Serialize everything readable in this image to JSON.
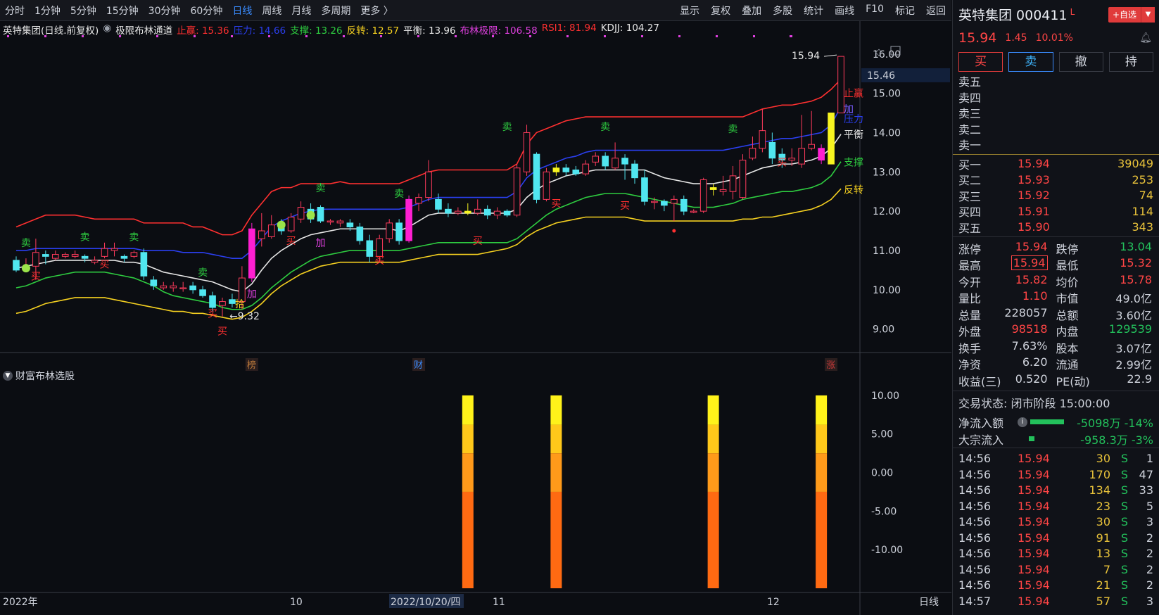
{
  "toolbar": {
    "periods": [
      "分时",
      "1分钟",
      "5分钟",
      "15分钟",
      "30分钟",
      "60分钟",
      "日线",
      "周线",
      "月线",
      "多周期",
      "更多 〉"
    ],
    "active_period": "日线",
    "tools": [
      "显示",
      "复权",
      "叠加",
      "多股",
      "统计",
      "画线",
      "F10",
      "标记",
      "返回"
    ]
  },
  "legend": {
    "title": "英特集团(日线.前复权)",
    "indicator": "极限布林通道",
    "items": [
      {
        "label": "止赢: 15.36",
        "color": "#ff3030"
      },
      {
        "label": "压力: 14.66",
        "color": "#2b3ff0"
      },
      {
        "label": "支撑: 13.26",
        "color": "#2ecc40"
      },
      {
        "label": "反转: 12.57",
        "color": "#f5d020"
      },
      {
        "label": "平衡: 13.96",
        "color": "#e6e6e6"
      },
      {
        "label": "布林极限: 106.58",
        "color": "#e040e0"
      },
      {
        "label": "RSI1: 81.94",
        "color": "#ff3030"
      },
      {
        "label": "KDJJ: 104.27",
        "color": "#e6e6e6"
      }
    ]
  },
  "sub_chart_title": "财富布林选股",
  "main_axis": [
    "16.00",
    "15.00",
    "14.00",
    "13.00",
    "12.00",
    "11.00",
    "10.00",
    "9.00"
  ],
  "current_price_tag": "15.46",
  "sub_axis": [
    "10.00",
    "5.00",
    "0.00",
    "-5.00",
    "-10.00"
  ],
  "x_axis": {
    "labels": [
      "2022年",
      "10",
      "2022/10/20/四",
      "11",
      "12"
    ],
    "period_label": "日线"
  },
  "annotations": {
    "high_label": "15.94",
    "low_label": "9.32",
    "band_labels": [
      "止赢",
      "加",
      "压力",
      "平衡",
      "支撑",
      "反转"
    ],
    "buy_mark": "买",
    "sell_mark": "卖",
    "add_mark": "加",
    "pick_mark": "拾",
    "markers": [
      "榜",
      "财",
      "涨"
    ]
  },
  "chart_data": {
    "type": "candlestick",
    "ylim": [
      8.6,
      16.3
    ],
    "candles": [
      [
        10.75,
        10.5,
        10.85,
        10.45
      ],
      [
        10.55,
        10.6,
        10.8,
        10.45
      ],
      [
        10.6,
        10.95,
        11.3,
        10.25
      ],
      [
        10.9,
        10.85,
        11.0,
        10.65
      ],
      [
        10.8,
        10.9,
        11.0,
        10.75
      ],
      [
        10.85,
        10.9,
        10.95,
        10.8
      ],
      [
        10.85,
        10.9,
        11.0,
        10.8
      ],
      [
        10.85,
        10.8,
        10.9,
        10.7
      ],
      [
        10.7,
        10.75,
        10.85,
        10.65
      ],
      [
        10.85,
        11.05,
        11.2,
        10.8
      ],
      [
        11.0,
        11.05,
        11.2,
        10.85
      ],
      [
        10.85,
        10.8,
        10.9,
        10.7
      ],
      [
        10.85,
        10.95,
        11.0,
        10.8
      ],
      [
        10.95,
        10.35,
        11.05,
        10.25
      ],
      [
        10.25,
        10.1,
        10.35,
        10.0
      ],
      [
        10.05,
        10.1,
        10.2,
        10.0
      ],
      [
        10.05,
        10.1,
        10.2,
        9.95
      ],
      [
        10.05,
        10.05,
        10.2,
        9.95
      ],
      [
        10.1,
        10.0,
        10.2,
        9.9
      ],
      [
        10.0,
        9.85,
        10.1,
        9.8
      ],
      [
        9.85,
        9.55,
        9.95,
        9.45
      ],
      [
        9.6,
        9.7,
        9.8,
        9.32
      ],
      [
        9.75,
        9.65,
        9.9,
        9.55
      ],
      [
        9.7,
        10.3,
        10.6,
        9.5
      ],
      [
        10.3,
        11.55,
        11.7,
        10.2
      ],
      [
        11.3,
        11.5,
        11.95,
        11.1
      ],
      [
        11.35,
        11.65,
        11.9,
        11.3
      ],
      [
        11.65,
        11.5,
        11.8,
        11.4
      ],
      [
        11.5,
        11.85,
        11.95,
        11.45
      ],
      [
        11.8,
        12.1,
        12.25,
        11.7
      ],
      [
        12.05,
        11.8,
        12.2,
        11.7
      ],
      [
        12.1,
        11.75,
        12.15,
        11.7
      ],
      [
        11.75,
        11.75,
        11.8,
        11.65
      ],
      [
        11.7,
        11.75,
        11.8,
        11.6
      ],
      [
        11.7,
        11.6,
        11.8,
        11.5
      ],
      [
        11.6,
        11.25,
        11.7,
        11.15
      ],
      [
        11.25,
        10.85,
        11.4,
        10.7
      ],
      [
        10.85,
        11.3,
        11.4,
        10.7
      ],
      [
        11.3,
        11.7,
        11.8,
        11.2
      ],
      [
        11.7,
        11.25,
        11.8,
        11.15
      ],
      [
        11.25,
        12.3,
        12.4,
        11.2
      ],
      [
        12.2,
        12.35,
        12.45,
        12.0
      ],
      [
        12.35,
        13.0,
        13.3,
        12.25
      ],
      [
        12.3,
        12.05,
        12.45,
        11.95
      ],
      [
        12.05,
        11.95,
        12.2,
        11.85
      ],
      [
        11.95,
        12.0,
        12.1,
        11.9
      ],
      [
        12.0,
        11.95,
        12.2,
        11.9
      ],
      [
        11.95,
        12.05,
        12.3,
        11.9
      ],
      [
        12.05,
        11.9,
        12.15,
        11.8
      ],
      [
        11.9,
        12.0,
        12.1,
        11.8
      ],
      [
        12.0,
        11.9,
        12.05,
        11.85
      ],
      [
        11.9,
        13.1,
        13.2,
        11.85
      ],
      [
        13.0,
        14.0,
        14.2,
        12.9
      ],
      [
        13.45,
        12.3,
        13.5,
        12.2
      ],
      [
        12.3,
        13.0,
        13.1,
        12.25
      ],
      [
        13.0,
        13.1,
        13.2,
        12.9
      ],
      [
        13.1,
        13.0,
        13.2,
        12.9
      ],
      [
        13.05,
        12.95,
        13.15,
        12.9
      ],
      [
        12.95,
        13.2,
        13.3,
        12.9
      ],
      [
        13.25,
        13.4,
        13.5,
        13.15
      ],
      [
        13.4,
        13.15,
        13.5,
        13.05
      ],
      [
        13.1,
        13.35,
        13.75,
        13.05
      ],
      [
        13.35,
        13.2,
        13.45,
        12.8
      ],
      [
        13.2,
        12.85,
        13.3,
        12.7
      ],
      [
        12.85,
        12.25,
        13.05,
        12.15
      ],
      [
        12.25,
        12.25,
        12.35,
        12.05
      ],
      [
        12.25,
        12.15,
        12.3,
        12.0
      ],
      [
        12.2,
        12.3,
        12.4,
        11.75
      ],
      [
        12.3,
        12.0,
        12.4,
        11.9
      ],
      [
        12.0,
        12.0,
        12.05,
        11.95
      ],
      [
        12.0,
        12.8,
        12.85,
        11.95
      ],
      [
        12.55,
        12.6,
        12.7,
        12.4
      ],
      [
        12.5,
        12.55,
        12.9,
        12.4
      ],
      [
        12.5,
        12.9,
        13.15,
        12.3
      ],
      [
        12.35,
        13.3,
        13.45,
        12.3
      ],
      [
        13.35,
        13.6,
        13.9,
        13.3
      ],
      [
        13.6,
        14.05,
        14.6,
        13.5
      ],
      [
        13.75,
        13.35,
        14.0,
        13.2
      ],
      [
        13.45,
        13.3,
        13.6,
        13.1
      ],
      [
        13.3,
        13.35,
        13.6,
        13.15
      ],
      [
        13.2,
        13.6,
        14.45,
        13.1
      ],
      [
        13.6,
        13.7,
        14.55,
        13.55
      ],
      [
        13.3,
        13.6,
        13.7,
        13.2
      ],
      [
        13.2,
        14.5,
        14.5,
        13.2
      ],
      [
        14.5,
        15.94,
        15.94,
        14.5
      ]
    ],
    "bands": {
      "upper_profit": [
        11.6,
        11.7,
        11.8,
        11.9,
        11.9,
        11.9,
        11.9,
        11.85,
        11.8,
        11.8,
        11.8,
        11.8,
        11.8,
        11.7,
        11.7,
        11.7,
        11.7,
        11.7,
        11.6,
        11.6,
        11.5,
        11.4,
        11.4,
        11.5,
        11.9,
        12.2,
        12.5,
        12.6,
        12.6,
        12.7,
        12.7,
        12.7,
        12.7,
        12.75,
        12.7,
        12.7,
        12.7,
        12.7,
        12.7,
        12.7,
        12.8,
        12.9,
        13.0,
        13.05,
        13.05,
        13.05,
        13.05,
        13.05,
        13.05,
        13.05,
        13.05,
        13.2,
        13.7,
        14.0,
        14.1,
        14.2,
        14.3,
        14.35,
        14.4,
        14.4,
        14.4,
        14.4,
        14.4,
        14.4,
        14.4,
        14.4,
        14.4,
        14.4,
        14.4,
        14.4,
        14.4,
        14.4,
        14.4,
        14.4,
        14.4,
        14.5,
        14.6,
        14.65,
        14.7,
        14.7,
        14.75,
        14.8,
        14.9,
        15.1,
        15.36
      ],
      "pressure": [
        11.0,
        11.0,
        11.05,
        11.05,
        11.05,
        11.05,
        11.05,
        11.05,
        11.05,
        11.05,
        11.05,
        11.05,
        11.05,
        11.0,
        11.0,
        11.0,
        11.0,
        10.95,
        10.95,
        10.95,
        10.9,
        10.85,
        10.8,
        10.8,
        11.0,
        11.3,
        11.6,
        11.75,
        11.85,
        11.95,
        12.0,
        12.05,
        12.05,
        12.05,
        12.05,
        12.05,
        12.05,
        12.05,
        12.05,
        12.05,
        12.1,
        12.2,
        12.3,
        12.35,
        12.35,
        12.35,
        12.35,
        12.35,
        12.35,
        12.35,
        12.35,
        12.5,
        12.85,
        13.05,
        13.15,
        13.25,
        13.35,
        13.4,
        13.5,
        13.55,
        13.55,
        13.55,
        13.55,
        13.55,
        13.55,
        13.55,
        13.55,
        13.55,
        13.55,
        13.55,
        13.55,
        13.55,
        13.55,
        13.6,
        13.65,
        13.7,
        13.75,
        13.8,
        13.85,
        13.85,
        13.9,
        13.95,
        14.0,
        14.2,
        14.66
      ],
      "balance": [
        10.55,
        10.6,
        10.65,
        10.7,
        10.75,
        10.75,
        10.75,
        10.75,
        10.75,
        10.75,
        10.75,
        10.7,
        10.7,
        10.65,
        10.55,
        10.45,
        10.4,
        10.35,
        10.3,
        10.25,
        10.2,
        10.1,
        10.0,
        9.95,
        10.15,
        10.5,
        10.8,
        11.0,
        11.15,
        11.3,
        11.4,
        11.45,
        11.5,
        11.55,
        11.55,
        11.55,
        11.55,
        11.55,
        11.55,
        11.5,
        11.6,
        11.75,
        11.9,
        11.95,
        11.95,
        11.95,
        11.95,
        11.95,
        11.95,
        11.95,
        11.95,
        12.05,
        12.35,
        12.55,
        12.7,
        12.8,
        12.9,
        12.95,
        13.0,
        13.05,
        13.05,
        13.05,
        13.05,
        13.05,
        13.05,
        12.95,
        12.85,
        12.8,
        12.75,
        12.7,
        12.7,
        12.7,
        12.75,
        12.8,
        12.9,
        13.0,
        13.1,
        13.15,
        13.2,
        13.2,
        13.25,
        13.3,
        13.4,
        13.6,
        13.96
      ],
      "support": [
        10.05,
        10.1,
        10.2,
        10.3,
        10.35,
        10.4,
        10.45,
        10.45,
        10.45,
        10.45,
        10.4,
        10.35,
        10.3,
        10.2,
        10.1,
        9.95,
        9.85,
        9.8,
        9.75,
        9.7,
        9.65,
        9.55,
        9.5,
        9.5,
        9.6,
        9.8,
        10.05,
        10.25,
        10.45,
        10.6,
        10.75,
        10.85,
        10.9,
        10.95,
        11.0,
        11.0,
        11.0,
        11.0,
        11.0,
        11.0,
        11.05,
        11.1,
        11.15,
        11.2,
        11.2,
        11.2,
        11.2,
        11.2,
        11.2,
        11.2,
        11.2,
        11.3,
        11.5,
        11.7,
        11.9,
        12.05,
        12.15,
        12.25,
        12.35,
        12.4,
        12.45,
        12.45,
        12.45,
        12.4,
        12.35,
        12.3,
        12.25,
        12.2,
        12.15,
        12.1,
        12.1,
        12.1,
        12.15,
        12.2,
        12.3,
        12.35,
        12.4,
        12.45,
        12.5,
        12.5,
        12.55,
        12.6,
        12.7,
        12.9,
        13.26
      ],
      "reversal": [
        9.4,
        9.45,
        9.55,
        9.65,
        9.7,
        9.75,
        9.8,
        9.8,
        9.8,
        9.8,
        9.75,
        9.7,
        9.65,
        9.6,
        9.55,
        9.5,
        9.45,
        9.45,
        9.4,
        9.4,
        9.35,
        9.3,
        9.25,
        9.3,
        9.45,
        9.65,
        9.9,
        10.1,
        10.25,
        10.4,
        10.5,
        10.6,
        10.65,
        10.7,
        10.7,
        10.7,
        10.7,
        10.7,
        10.7,
        10.7,
        10.75,
        10.8,
        10.85,
        10.9,
        10.9,
        10.9,
        10.9,
        10.9,
        10.95,
        11.0,
        11.05,
        11.15,
        11.35,
        11.5,
        11.6,
        11.7,
        11.75,
        11.8,
        11.85,
        11.85,
        11.85,
        11.85,
        11.85,
        11.8,
        11.75,
        11.75,
        11.75,
        11.75,
        11.75,
        11.75,
        11.75,
        11.75,
        11.75,
        11.75,
        11.8,
        11.8,
        11.85,
        11.85,
        11.9,
        11.95,
        12.0,
        12.05,
        12.15,
        12.3,
        12.57
      ]
    },
    "sub_bars": [
      {
        "index": 46,
        "value": 10
      },
      {
        "index": 55,
        "value": 10
      },
      {
        "index": 71,
        "value": 10
      },
      {
        "index": 82,
        "value": 10
      }
    ],
    "sub_ylim": [
      -15,
      12
    ]
  },
  "panel": {
    "name": "英特集团 000411",
    "name_tag": "L",
    "add_label": "+自选",
    "price": "15.94",
    "change": "1.45",
    "change_pct": "10.01%",
    "buttons": {
      "buy": "买",
      "sell": "卖",
      "cancel": "撤",
      "hold": "持"
    },
    "asks": [
      {
        "label": "卖五",
        "price": "",
        "vol": ""
      },
      {
        "label": "卖四",
        "price": "",
        "vol": ""
      },
      {
        "label": "卖三",
        "price": "",
        "vol": ""
      },
      {
        "label": "卖二",
        "price": "",
        "vol": ""
      },
      {
        "label": "卖一",
        "price": "",
        "vol": ""
      }
    ],
    "bids": [
      {
        "label": "买一",
        "price": "15.94",
        "vol": "39049"
      },
      {
        "label": "买二",
        "price": "15.93",
        "vol": "253"
      },
      {
        "label": "买三",
        "price": "15.92",
        "vol": "74"
      },
      {
        "label": "买四",
        "price": "15.91",
        "vol": "114"
      },
      {
        "label": "买五",
        "price": "15.90",
        "vol": "343"
      }
    ],
    "stats": [
      [
        {
          "k": "涨停",
          "v": "15.94",
          "cls": "red"
        },
        {
          "k": "跌停",
          "v": "13.04",
          "cls": "green"
        }
      ],
      [
        {
          "k": "最高",
          "v": "15.94",
          "cls": "red boxed"
        },
        {
          "k": "最低",
          "v": "15.32",
          "cls": "red"
        }
      ],
      [
        {
          "k": "今开",
          "v": "15.82",
          "cls": "red"
        },
        {
          "k": "均价",
          "v": "15.78",
          "cls": "red"
        }
      ],
      [
        {
          "k": "量比",
          "v": "1.10",
          "cls": "red"
        },
        {
          "k": "市值",
          "v": "49.0亿",
          "cls": ""
        }
      ],
      [
        {
          "k": "总量",
          "v": "228057",
          "cls": ""
        },
        {
          "k": "总额",
          "v": "3.60亿",
          "cls": ""
        }
      ],
      [
        {
          "k": "外盘",
          "v": "98518",
          "cls": "red"
        },
        {
          "k": "内盘",
          "v": "129539",
          "cls": "green"
        }
      ],
      [
        {
          "k": "换手",
          "v": "7.63%",
          "cls": ""
        },
        {
          "k": "股本",
          "v": "3.07亿",
          "cls": ""
        }
      ],
      [
        {
          "k": "净资",
          "v": "6.20",
          "cls": ""
        },
        {
          "k": "流通",
          "v": "2.99亿",
          "cls": ""
        }
      ],
      [
        {
          "k": "收益(三)",
          "v": "0.520",
          "cls": ""
        },
        {
          "k": "PE(动)",
          "v": "22.9",
          "cls": ""
        }
      ]
    ],
    "status": "交易状态: 闭市阶段 15:00:00",
    "net_inflow_label": "净流入额",
    "net_inflow_value": "-5098万 -14%",
    "block_inflow_label": "大宗流入",
    "block_inflow_value": "-958.3万  -3%",
    "ticks": [
      {
        "t": "14:56",
        "p": "15.94",
        "q": "30",
        "s": "S",
        "n": "1"
      },
      {
        "t": "14:56",
        "p": "15.94",
        "q": "170",
        "s": "S",
        "n": "47"
      },
      {
        "t": "14:56",
        "p": "15.94",
        "q": "134",
        "s": "S",
        "n": "33"
      },
      {
        "t": "14:56",
        "p": "15.94",
        "q": "23",
        "s": "S",
        "n": "5"
      },
      {
        "t": "14:56",
        "p": "15.94",
        "q": "30",
        "s": "S",
        "n": "3"
      },
      {
        "t": "14:56",
        "p": "15.94",
        "q": "91",
        "s": "S",
        "n": "2"
      },
      {
        "t": "14:56",
        "p": "15.94",
        "q": "13",
        "s": "S",
        "n": "2"
      },
      {
        "t": "14:56",
        "p": "15.94",
        "q": "7",
        "s": "S",
        "n": "2"
      },
      {
        "t": "14:56",
        "p": "15.94",
        "q": "21",
        "s": "S",
        "n": "2"
      },
      {
        "t": "14:57",
        "p": "15.94",
        "q": "57",
        "s": "S",
        "n": "3"
      }
    ]
  }
}
